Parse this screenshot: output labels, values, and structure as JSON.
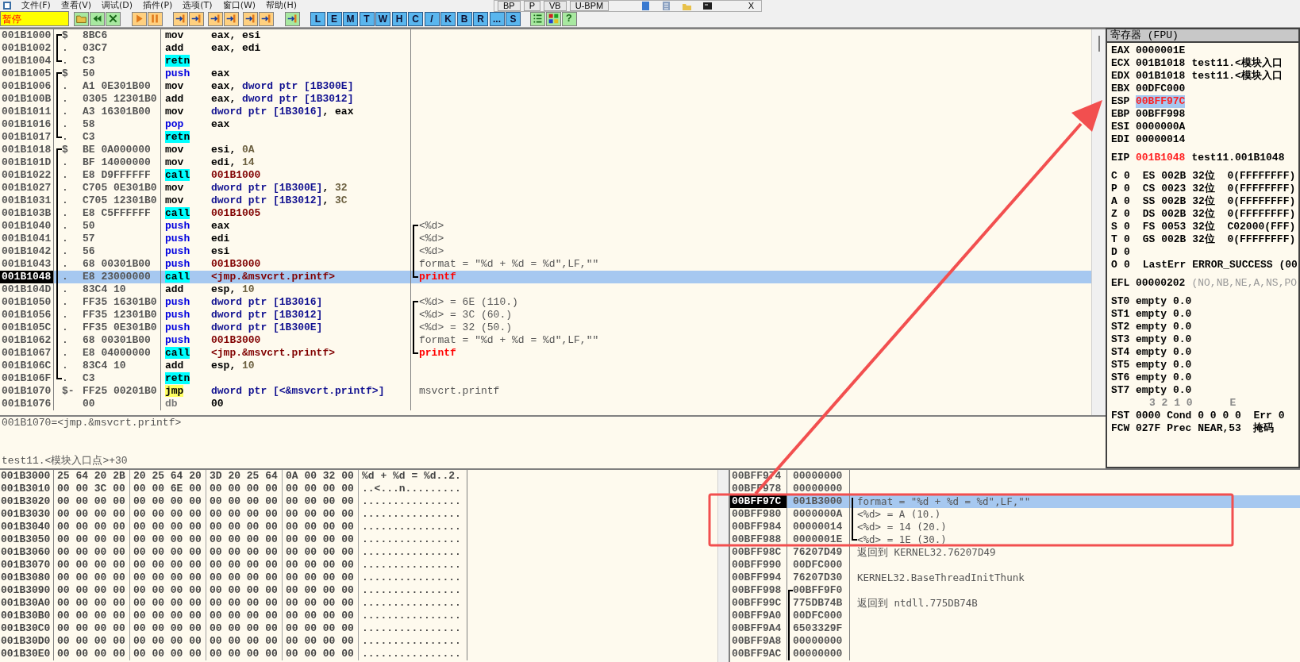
{
  "menu": [
    "文件(F)",
    "查看(V)",
    "调试(D)",
    "插件(P)",
    "选项(T)",
    "窗口(W)",
    "帮助(H)"
  ],
  "floating_toolbar": {
    "buttons": [
      "BP",
      "P",
      "VB",
      "U-BPM"
    ],
    "close_label": "X"
  },
  "toolbar": {
    "status": "暂停",
    "letter_buttons": [
      "L",
      "E",
      "M",
      "T",
      "W",
      "H",
      "C",
      "/",
      "K",
      "B",
      "R",
      "...",
      "S"
    ],
    "help_label": "?"
  },
  "disassembly": {
    "rows": [
      {
        "address": "001B1000",
        "marker": "$",
        "bracket": {
          "kind": "start"
        },
        "hex": "8BC6",
        "mnemonic": "mov",
        "kind": "plain",
        "operands": [
          {
            "text": "eax, esi",
            "kind": "reg"
          }
        ],
        "selected": false
      },
      {
        "address": "001B1002",
        "marker": ".",
        "bracket": {
          "kind": "mid"
        },
        "hex": "03C7",
        "mnemonic": "add",
        "kind": "plain",
        "operands": [
          {
            "text": "eax, edi",
            "kind": "reg"
          }
        ],
        "selected": false
      },
      {
        "address": "001B1004",
        "marker": ".",
        "bracket": {
          "kind": "end"
        },
        "hex": "C3",
        "mnemonic": "retn",
        "kind": "call",
        "selected": false
      },
      {
        "address": "001B1005",
        "marker": "$",
        "bracket": {
          "kind": "start"
        },
        "hex": "50",
        "mnemonic": "push",
        "kind": "stack",
        "operands": [
          {
            "text": "eax",
            "kind": "reg"
          }
        ],
        "selected": false
      },
      {
        "address": "001B1006",
        "marker": ".",
        "bracket": {
          "kind": "mid"
        },
        "hex": "A1 0E301B00",
        "mnemonic": "mov",
        "kind": "plain",
        "operands": [
          {
            "text": "eax, ",
            "kind": "reg"
          },
          {
            "text": "dword ptr [1B300E]",
            "kind": "mem"
          }
        ],
        "selected": false
      },
      {
        "address": "001B100B",
        "marker": ".",
        "bracket": {
          "kind": "mid"
        },
        "hex": "0305 12301B0",
        "mnemonic": "add",
        "kind": "plain",
        "operands": [
          {
            "text": "eax, ",
            "kind": "reg"
          },
          {
            "text": "dword ptr [1B3012]",
            "kind": "mem"
          }
        ],
        "selected": false
      },
      {
        "address": "001B1011",
        "marker": ".",
        "bracket": {
          "kind": "mid"
        },
        "hex": "A3 16301B00",
        "mnemonic": "mov",
        "kind": "plain",
        "operands": [
          {
            "text": "dword ptr [1B3016]",
            "kind": "mem"
          },
          {
            "text": ", eax",
            "kind": "reg"
          }
        ],
        "selected": false
      },
      {
        "address": "001B1016",
        "marker": ".",
        "bracket": {
          "kind": "mid"
        },
        "hex": "58",
        "mnemonic": "pop",
        "kind": "stack",
        "operands": [
          {
            "text": "eax",
            "kind": "reg"
          }
        ],
        "selected": false
      },
      {
        "address": "001B1017",
        "marker": ".",
        "bracket": {
          "kind": "end"
        },
        "hex": "C3",
        "mnemonic": "retn",
        "kind": "call",
        "selected": false
      },
      {
        "address": "001B1018",
        "marker": "$",
        "bracket": {
          "kind": "start"
        },
        "hex": "BE 0A000000",
        "mnemonic": "mov",
        "kind": "plain",
        "operands": [
          {
            "text": "esi, ",
            "kind": "reg"
          },
          {
            "text": "0A",
            "kind": "imm"
          }
        ],
        "selected": false
      },
      {
        "address": "001B101D",
        "marker": ".",
        "bracket": {
          "kind": "mid"
        },
        "hex": "BF 14000000",
        "mnemonic": "mov",
        "kind": "plain",
        "operands": [
          {
            "text": "edi, ",
            "kind": "reg"
          },
          {
            "text": "14",
            "kind": "imm"
          }
        ],
        "selected": false
      },
      {
        "address": "001B1022",
        "marker": ".",
        "bracket": {
          "kind": "mid"
        },
        "hex": "E8 D9FFFFFF",
        "mnemonic": "call",
        "kind": "call",
        "operands": [
          {
            "text": "001B1000",
            "kind": "addr"
          }
        ],
        "selected": false
      },
      {
        "address": "001B1027",
        "marker": ".",
        "bracket": {
          "kind": "mid"
        },
        "hex": "C705 0E301B0",
        "mnemonic": "mov",
        "kind": "plain",
        "operands": [
          {
            "text": "dword ptr [1B300E]",
            "kind": "mem"
          },
          {
            "text": ", ",
            "kind": "reg"
          },
          {
            "text": "32",
            "kind": "imm"
          }
        ],
        "selected": false
      },
      {
        "address": "001B1031",
        "marker": ".",
        "bracket": {
          "kind": "mid"
        },
        "hex": "C705 12301B0",
        "mnemonic": "mov",
        "kind": "plain",
        "operands": [
          {
            "text": "dword ptr [1B3012]",
            "kind": "mem"
          },
          {
            "text": ", ",
            "kind": "reg"
          },
          {
            "text": "3C",
            "kind": "imm"
          }
        ],
        "selected": false
      },
      {
        "address": "001B103B",
        "marker": ".",
        "bracket": {
          "kind": "mid"
        },
        "hex": "E8 C5FFFFFF",
        "mnemonic": "call",
        "kind": "call",
        "operands": [
          {
            "text": "001B1005",
            "kind": "addr"
          }
        ],
        "selected": false
      },
      {
        "address": "001B1040",
        "marker": ".",
        "bracket": {
          "kind": "mid"
        },
        "hex": "50",
        "mnemonic": "push",
        "kind": "stack",
        "operands": [
          {
            "text": "eax",
            "kind": "reg"
          }
        ],
        "comment": {
          "text": "<%d>",
          "bracket": {
            "kind": "start"
          },
          "kind": "note"
        },
        "selected": false
      },
      {
        "address": "001B1041",
        "marker": ".",
        "bracket": {
          "kind": "mid"
        },
        "hex": "57",
        "mnemonic": "push",
        "kind": "stack",
        "operands": [
          {
            "text": "edi",
            "kind": "reg"
          }
        ],
        "comment": {
          "text": "<%d>",
          "bracket": {
            "kind": "mid"
          },
          "kind": "note"
        },
        "selected": false
      },
      {
        "address": "001B1042",
        "marker": ".",
        "bracket": {
          "kind": "mid"
        },
        "hex": "56",
        "mnemonic": "push",
        "kind": "stack",
        "operands": [
          {
            "text": "esi",
            "kind": "reg"
          }
        ],
        "comment": {
          "text": "<%d>",
          "bracket": {
            "kind": "mid"
          },
          "kind": "note"
        },
        "selected": false
      },
      {
        "address": "001B1043",
        "marker": ".",
        "bracket": {
          "kind": "mid"
        },
        "hex": "68 00301B00",
        "mnemonic": "push",
        "kind": "stack",
        "operands": [
          {
            "text": "001B3000",
            "kind": "addr"
          }
        ],
        "comment": {
          "text": "format = \"%d + %d = %d\",LF,\"\"",
          "bracket": {
            "kind": "mid"
          },
          "kind": "note"
        },
        "selected": false
      },
      {
        "address": "001B1048",
        "marker": ".",
        "bracket": {
          "kind": "mid"
        },
        "hex": "E8 23000000",
        "mnemonic": "call",
        "kind": "call",
        "operands": [
          {
            "text": "<jmp.&msvcrt.printf>",
            "kind": "addr"
          }
        ],
        "comment": {
          "text": "printf",
          "bracket": {
            "kind": "end"
          },
          "kind": "call"
        },
        "selected": true
      },
      {
        "address": "001B104D",
        "marker": ".",
        "bracket": {
          "kind": "mid"
        },
        "hex": "83C4 10",
        "mnemonic": "add",
        "kind": "plain",
        "operands": [
          {
            "text": "esp, ",
            "kind": "reg"
          },
          {
            "text": "10",
            "kind": "imm"
          }
        ],
        "selected": false
      },
      {
        "address": "001B1050",
        "marker": ".",
        "bracket": {
          "kind": "mid"
        },
        "hex": "FF35 16301B0",
        "mnemonic": "push",
        "kind": "stack",
        "operands": [
          {
            "text": "dword ptr [1B3016]",
            "kind": "mem"
          }
        ],
        "comment": {
          "text": "<%d> = 6E (110.)",
          "bracket": {
            "kind": "start"
          },
          "kind": "note"
        },
        "selected": false
      },
      {
        "address": "001B1056",
        "marker": ".",
        "bracket": {
          "kind": "mid"
        },
        "hex": "FF35 12301B0",
        "mnemonic": "push",
        "kind": "stack",
        "operands": [
          {
            "text": "dword ptr [1B3012]",
            "kind": "mem"
          }
        ],
        "comment": {
          "text": "<%d> = 3C (60.)",
          "bracket": {
            "kind": "mid"
          },
          "kind": "note"
        },
        "selected": false
      },
      {
        "address": "001B105C",
        "marker": ".",
        "bracket": {
          "kind": "mid"
        },
        "hex": "FF35 0E301B0",
        "mnemonic": "push",
        "kind": "stack",
        "operands": [
          {
            "text": "dword ptr [1B300E]",
            "kind": "mem"
          }
        ],
        "comment": {
          "text": "<%d> = 32 (50.)",
          "bracket": {
            "kind": "mid"
          },
          "kind": "note"
        },
        "selected": false
      },
      {
        "address": "001B1062",
        "marker": ".",
        "bracket": {
          "kind": "mid"
        },
        "hex": "68 00301B00",
        "mnemonic": "push",
        "kind": "stack",
        "operands": [
          {
            "text": "001B3000",
            "kind": "addr"
          }
        ],
        "comment": {
          "text": "format = \"%d + %d = %d\",LF,\"\"",
          "bracket": {
            "kind": "mid"
          },
          "kind": "note"
        },
        "selected": false
      },
      {
        "address": "001B1067",
        "marker": ".",
        "bracket": {
          "kind": "mid"
        },
        "hex": "E8 04000000",
        "mnemonic": "call",
        "kind": "call",
        "operands": [
          {
            "text": "<jmp.&msvcrt.printf>",
            "kind": "addr"
          }
        ],
        "comment": {
          "text": "printf",
          "bracket": {
            "kind": "end"
          },
          "kind": "call"
        },
        "selected": false
      },
      {
        "address": "001B106C",
        "marker": ".",
        "bracket": {
          "kind": "mid"
        },
        "hex": "83C4 10",
        "mnemonic": "add",
        "kind": "plain",
        "operands": [
          {
            "text": "esp, ",
            "kind": "reg"
          },
          {
            "text": "10",
            "kind": "imm"
          }
        ],
        "selected": false
      },
      {
        "address": "001B106F",
        "marker": ".",
        "bracket": {
          "kind": "end"
        },
        "hex": "C3",
        "mnemonic": "retn",
        "kind": "call",
        "selected": false
      },
      {
        "address": "001B1070",
        "marker": "$-",
        "hex": "FF25 00201B0",
        "mnemonic": "jmp",
        "kind": "jump",
        "operands": [
          {
            "text": "dword ptr [<&msvcrt.printf>]",
            "kind": "mem"
          }
        ],
        "comment": {
          "text": "msvcrt.printf",
          "kind": "note"
        },
        "selected": false
      },
      {
        "address": "001B1076",
        "hex": "00",
        "mnemonic": "db",
        "kind": "data",
        "operands": [
          {
            "text": "00",
            "kind": "reg"
          }
        ],
        "selected": false
      }
    ]
  },
  "info": [
    "001B1070=<jmp.&msvcrt.printf>",
    "test11.<模块入口点>+30"
  ],
  "registers": {
    "title": "寄存器 (FPU)",
    "groups": [
      [
        {
          "kind": "register",
          "name": "EAX",
          "value": "0000001E",
          "changed": false,
          "selected": false
        },
        {
          "kind": "register",
          "name": "ECX",
          "value": "001B1018",
          "comment": "test11.<模块入口",
          "changed": false,
          "selected": false
        },
        {
          "kind": "register",
          "name": "EDX",
          "value": "001B1018",
          "comment": "test11.<模块入口",
          "changed": false,
          "selected": false
        },
        {
          "kind": "register",
          "name": "EBX",
          "value": "00DFC000",
          "changed": false,
          "selected": false
        },
        {
          "kind": "register",
          "name": "ESP",
          "value": "00BFF97C",
          "changed": true,
          "selected": true
        },
        {
          "kind": "register",
          "name": "EBP",
          "value": "00BFF998",
          "changed": false,
          "selected": false
        },
        {
          "kind": "register",
          "name": "ESI",
          "value": "0000000A",
          "changed": false,
          "selected": false
        },
        {
          "kind": "register",
          "name": "EDI",
          "value": "00000014",
          "changed": false,
          "selected": false
        }
      ],
      [
        {
          "kind": "register",
          "name": "EIP",
          "value": "001B1048",
          "comment": "test11.001B1048",
          "changed": true,
          "selected": false
        }
      ],
      [
        {
          "kind": "flag",
          "name": "C",
          "value": "0",
          "comment": "ES 002B 32位  0(FFFFFFFF)",
          "changed": false,
          "selected": false
        },
        {
          "kind": "flag",
          "name": "P",
          "value": "0",
          "comment": "CS 0023 32位  0(FFFFFFFF)",
          "changed": false,
          "selected": false
        },
        {
          "kind": "flag",
          "name": "A",
          "value": "0",
          "comment": "SS 002B 32位  0(FFFFFFFF)",
          "changed": false,
          "selected": false
        },
        {
          "kind": "flag",
          "name": "Z",
          "value": "0",
          "comment": "DS 002B 32位  0(FFFFFFFF)",
          "changed": false,
          "selected": false
        },
        {
          "kind": "flag",
          "name": "S",
          "value": "0",
          "comment": "FS 0053 32位  C02000(FFF)",
          "changed": false,
          "selected": false
        },
        {
          "kind": "flag",
          "name": "T",
          "value": "0",
          "comment": "GS 002B 32位  0(FFFFFFFF)",
          "changed": false,
          "selected": false
        },
        {
          "kind": "flag",
          "name": "D",
          "value": "0",
          "changed": false,
          "selected": false
        },
        {
          "kind": "flag",
          "name": "O",
          "value": "0",
          "comment": "LastErr ERROR_SUCCESS (00",
          "changed": false,
          "selected": false
        }
      ],
      [
        {
          "kind": "register",
          "name": "EFL",
          "value": "00000202",
          "comment": "(NO,NB,NE,A,NS,PO",
          "dim": true,
          "changed": false,
          "selected": false
        }
      ],
      [
        {
          "kind": "register",
          "name": "ST0",
          "value": "empty",
          "comment": "0.0",
          "changed": false,
          "selected": false
        },
        {
          "kind": "register",
          "name": "ST1",
          "value": "empty",
          "comment": "0.0",
          "changed": false,
          "selected": false
        },
        {
          "kind": "register",
          "name": "ST2",
          "value": "empty",
          "comment": "0.0",
          "changed": false,
          "selected": false
        },
        {
          "kind": "register",
          "name": "ST3",
          "value": "empty",
          "comment": "0.0",
          "changed": false,
          "selected": false
        },
        {
          "kind": "register",
          "name": "ST4",
          "value": "empty",
          "comment": "0.0",
          "changed": false,
          "selected": false
        },
        {
          "kind": "register",
          "name": "ST5",
          "value": "empty",
          "comment": "0.0",
          "changed": false,
          "selected": false
        },
        {
          "kind": "register",
          "name": "ST6",
          "value": "empty",
          "comment": "0.0",
          "changed": false,
          "selected": false
        },
        {
          "kind": "register",
          "name": "ST7",
          "value": "empty",
          "comment": "0.0",
          "changed": false,
          "selected": false
        },
        {
          "kind": "caption",
          "text": "3 2 1 0      E"
        },
        {
          "kind": "register",
          "name": "FST",
          "value": "0000",
          "comment": "Cond 0 0 0 0  Err 0",
          "changed": false,
          "selected": false
        },
        {
          "kind": "register",
          "name": "FCW",
          "value": "027F",
          "comment": "Prec NEAR,53  掩码",
          "changed": false,
          "selected": false
        }
      ]
    ]
  },
  "dump": {
    "rows": [
      {
        "address": "001B3000",
        "bytes": [
          "25 64 20 2B",
          "20 25 64 20",
          "3D 20 25 64",
          "0A 00 32 00"
        ],
        "ascii": "%d + %d = %d..2."
      },
      {
        "address": "001B3010",
        "bytes": [
          "00 00 3C 00",
          "00 00 6E 00",
          "00 00 00 00",
          "00 00 00 00"
        ],
        "ascii": "..<...n........."
      },
      {
        "address": "001B3020",
        "bytes": [
          "00 00 00 00",
          "00 00 00 00",
          "00 00 00 00",
          "00 00 00 00"
        ],
        "ascii": "................"
      },
      {
        "address": "001B3030",
        "bytes": [
          "00 00 00 00",
          "00 00 00 00",
          "00 00 00 00",
          "00 00 00 00"
        ],
        "ascii": "................"
      },
      {
        "address": "001B3040",
        "bytes": [
          "00 00 00 00",
          "00 00 00 00",
          "00 00 00 00",
          "00 00 00 00"
        ],
        "ascii": "................"
      },
      {
        "address": "001B3050",
        "bytes": [
          "00 00 00 00",
          "00 00 00 00",
          "00 00 00 00",
          "00 00 00 00"
        ],
        "ascii": "................"
      },
      {
        "address": "001B3060",
        "bytes": [
          "00 00 00 00",
          "00 00 00 00",
          "00 00 00 00",
          "00 00 00 00"
        ],
        "ascii": "................"
      },
      {
        "address": "001B3070",
        "bytes": [
          "00 00 00 00",
          "00 00 00 00",
          "00 00 00 00",
          "00 00 00 00"
        ],
        "ascii": "................"
      },
      {
        "address": "001B3080",
        "bytes": [
          "00 00 00 00",
          "00 00 00 00",
          "00 00 00 00",
          "00 00 00 00"
        ],
        "ascii": "................"
      },
      {
        "address": "001B3090",
        "bytes": [
          "00 00 00 00",
          "00 00 00 00",
          "00 00 00 00",
          "00 00 00 00"
        ],
        "ascii": "................"
      },
      {
        "address": "001B30A0",
        "bytes": [
          "00 00 00 00",
          "00 00 00 00",
          "00 00 00 00",
          "00 00 00 00"
        ],
        "ascii": "................"
      },
      {
        "address": "001B30B0",
        "bytes": [
          "00 00 00 00",
          "00 00 00 00",
          "00 00 00 00",
          "00 00 00 00"
        ],
        "ascii": "................"
      },
      {
        "address": "001B30C0",
        "bytes": [
          "00 00 00 00",
          "00 00 00 00",
          "00 00 00 00",
          "00 00 00 00"
        ],
        "ascii": "................"
      },
      {
        "address": "001B30D0",
        "bytes": [
          "00 00 00 00",
          "00 00 00 00",
          "00 00 00 00",
          "00 00 00 00"
        ],
        "ascii": "................"
      },
      {
        "address": "001B30E0",
        "bytes": [
          "00 00 00 00",
          "00 00 00 00",
          "00 00 00 00",
          "00 00 00 00"
        ],
        "ascii": "................"
      }
    ]
  },
  "stack": {
    "rows": [
      {
        "address": "00BFF974",
        "value": "00000000",
        "selected": false
      },
      {
        "address": "00BFF978",
        "value": "00000000",
        "selected": false
      },
      {
        "address": "00BFF97C",
        "value": "001B3000",
        "bracket": {
          "kind": "top"
        },
        "comment": "format = \"%d + %d = %d\",LF,\"\"",
        "selected": true
      },
      {
        "address": "00BFF980",
        "value": "0000000A",
        "bracket": {
          "kind": "mid"
        },
        "comment": "<%d> = A (10.)",
        "selected": false
      },
      {
        "address": "00BFF984",
        "value": "00000014",
        "bracket": {
          "kind": "mid"
        },
        "comment": "<%d> = 14 (20.)",
        "selected": false
      },
      {
        "address": "00BFF988",
        "value": "0000001E",
        "bracket": {
          "kind": "end"
        },
        "comment": "<%d> = 1E (30.)",
        "selected": false
      },
      {
        "address": "00BFF98C",
        "value": "76207D49",
        "comment": "返回到 KERNEL32.76207D49",
        "selected": false
      },
      {
        "address": "00BFF990",
        "value": "00DFC000",
        "selected": false
      },
      {
        "address": "00BFF994",
        "value": "76207D30",
        "comment": "KERNEL32.BaseThreadInitThunk",
        "selected": false
      },
      {
        "address": "00BFF998",
        "value": "00BFF9F0",
        "bracket": {
          "kind": "start"
        },
        "value_bracket": true,
        "selected": false
      },
      {
        "address": "00BFF99C",
        "value": "775DB74B",
        "value_bracket": true,
        "comment": "返回到 ntdll.775DB74B",
        "selected": false
      },
      {
        "address": "00BFF9A0",
        "value": "00DFC000",
        "value_bracket": true,
        "selected": false
      },
      {
        "address": "00BFF9A4",
        "value": "6503329F",
        "value_bracket": true,
        "selected": false
      },
      {
        "address": "00BFF9A8",
        "value": "00000000",
        "value_bracket": true,
        "selected": false
      },
      {
        "address": "00BFF9AC",
        "value": "00000000",
        "value_bracket": true,
        "selected": false
      }
    ]
  },
  "annotations": {
    "arrow": true,
    "highlight_box": true
  }
}
